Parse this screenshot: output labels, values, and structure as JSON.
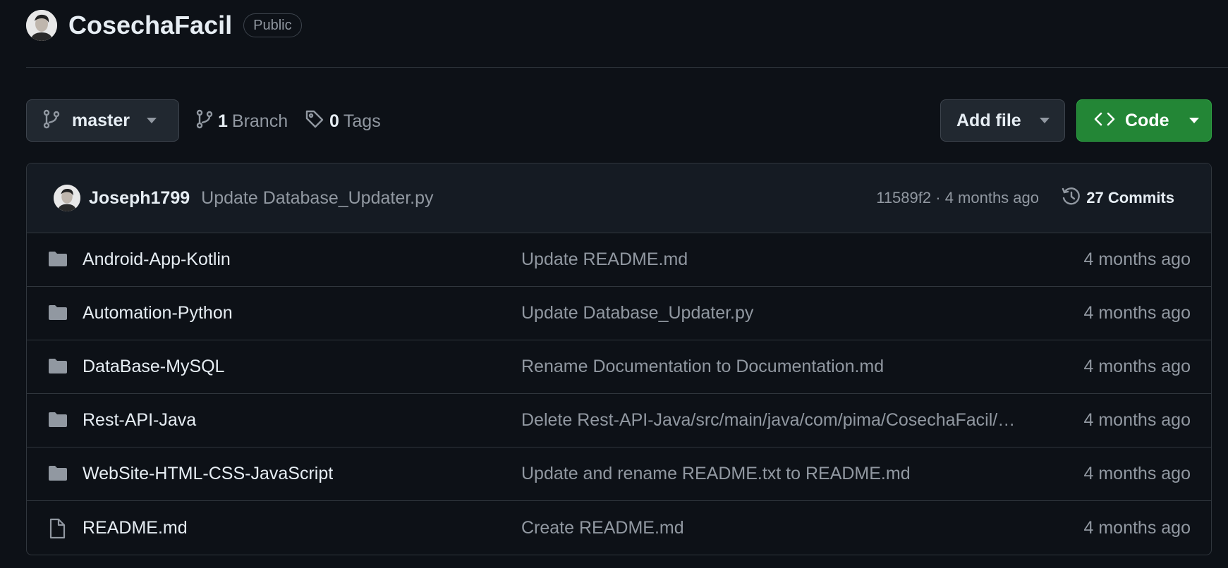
{
  "repo": {
    "name": "CosechaFacil",
    "visibility": "Public"
  },
  "toolbar": {
    "branch": "master",
    "branch_count": "1",
    "branch_label": "Branch",
    "tag_count": "0",
    "tag_label": "Tags",
    "add_file_label": "Add file",
    "code_label": "Code"
  },
  "latest_commit": {
    "author": "Joseph1799",
    "message": "Update Database_Updater.py",
    "sha": "11589f2",
    "separator": " · ",
    "age": "4 months ago",
    "commits_label": "27 Commits"
  },
  "files": [
    {
      "type": "folder",
      "icon": "folder-icon",
      "name": "Android-App-Kotlin",
      "commit": "Update README.md",
      "date": "4 months ago"
    },
    {
      "type": "folder",
      "icon": "folder-icon",
      "name": "Automation-Python",
      "commit": "Update Database_Updater.py",
      "date": "4 months ago"
    },
    {
      "type": "folder",
      "icon": "folder-icon",
      "name": "DataBase-MySQL",
      "commit": "Rename Documentation to Documentation.md",
      "date": "4 months ago"
    },
    {
      "type": "folder",
      "icon": "folder-icon",
      "name": "Rest-API-Java",
      "commit": "Delete Rest-API-Java/src/main/java/com/pima/CosechaFacil/…",
      "date": "4 months ago"
    },
    {
      "type": "folder",
      "icon": "folder-icon",
      "name": "WebSite-HTML-CSS-JavaScript",
      "commit": "Update and rename README.txt to README.md",
      "date": "4 months ago"
    },
    {
      "type": "file",
      "icon": "file-icon",
      "name": "README.md",
      "commit": "Create README.md",
      "date": "4 months ago"
    }
  ],
  "colors": {
    "background": "#0d1117",
    "border": "#30363d",
    "muted_text": "#9198a1",
    "primary_button": "#238636",
    "folder_icon": "#9198a1"
  }
}
